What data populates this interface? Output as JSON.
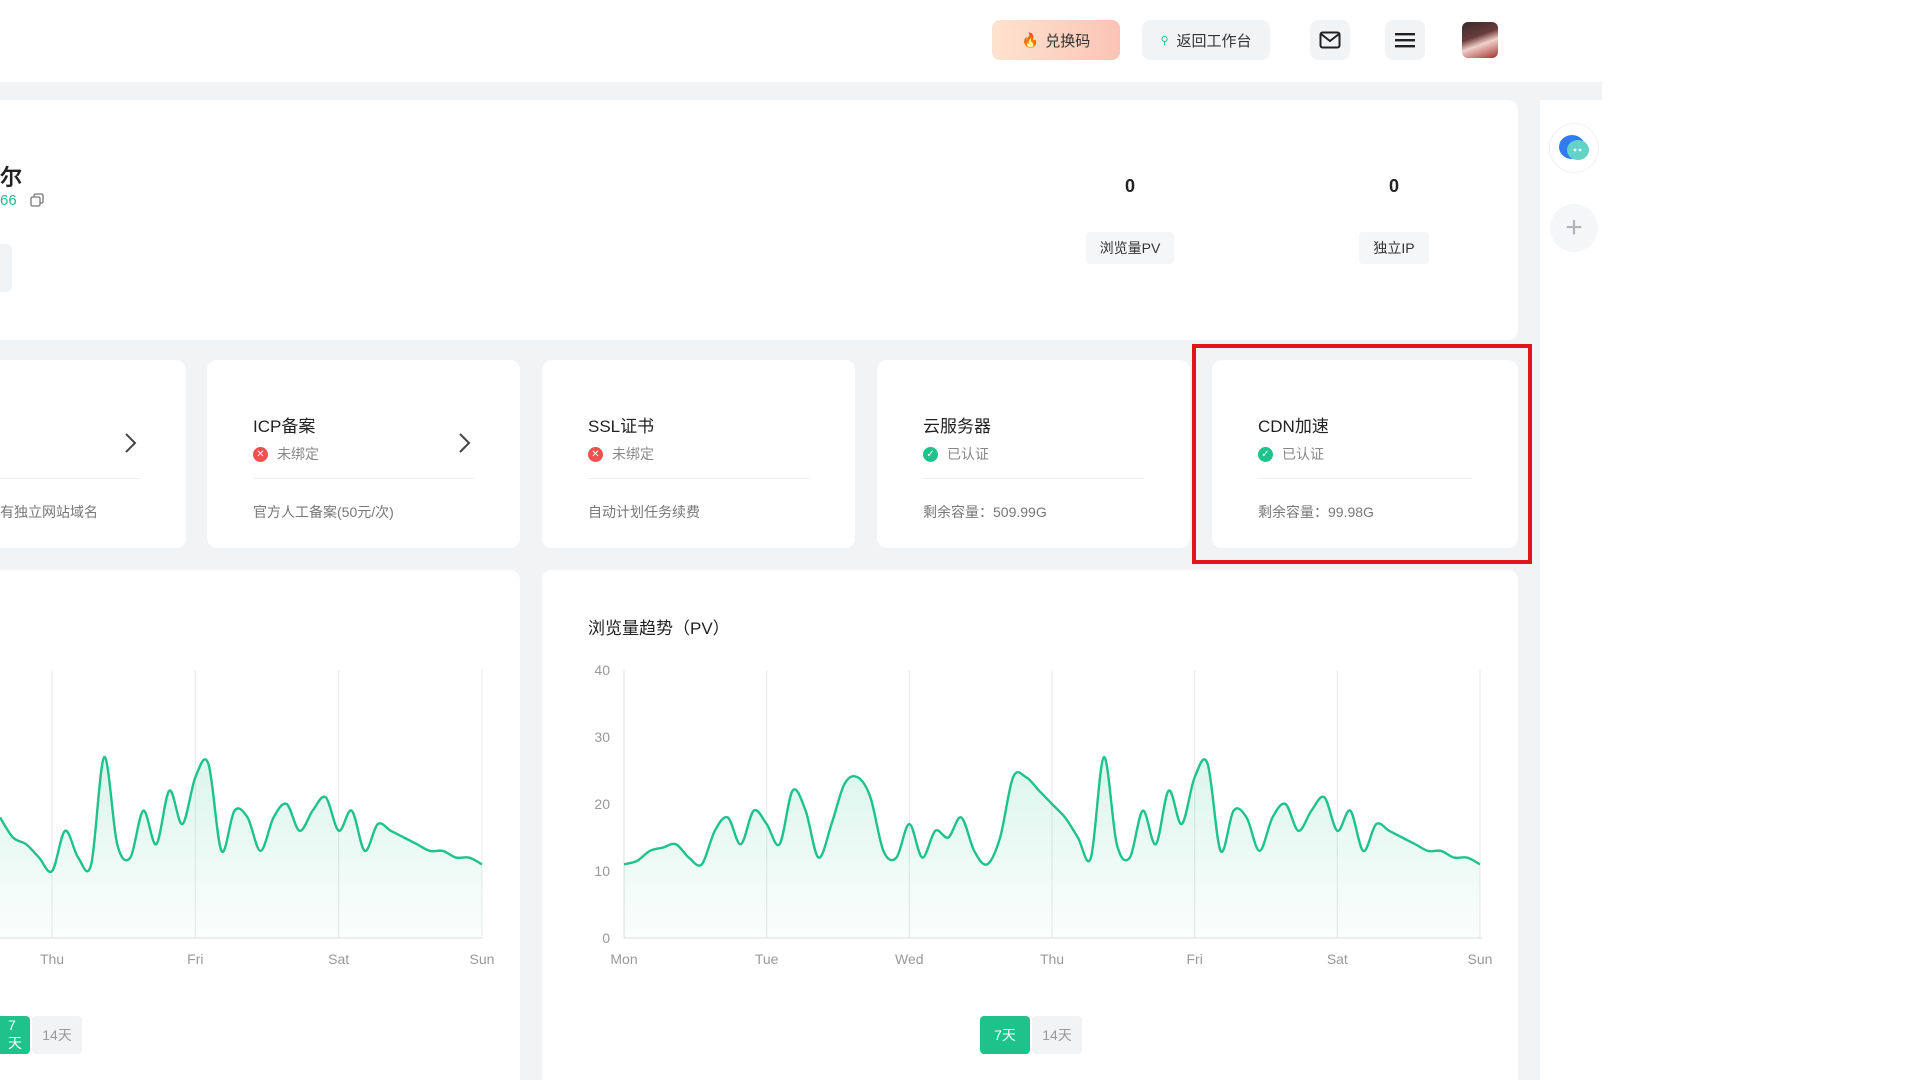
{
  "header": {
    "redeem_label": "兑换码",
    "back_label": "返回工作台"
  },
  "profile": {
    "name_fragment": "尔",
    "id_fragment": "66",
    "stats": [
      {
        "value": "0",
        "label": "浏览量PV"
      },
      {
        "value": "0",
        "label": "独立IP"
      }
    ]
  },
  "services": [
    {
      "title": "",
      "status": "",
      "note": "有独立网站域名",
      "ok": null
    },
    {
      "title": "ICP备案",
      "status": "未绑定",
      "note": "官方人工备案(50元/次)",
      "ok": false
    },
    {
      "title": "SSL证书",
      "status": "未绑定",
      "note": "自动计划任务续费",
      "ok": false
    },
    {
      "title": "云服务器",
      "status": "已认证",
      "note": "剩余容量：509.99G",
      "ok": true
    },
    {
      "title": "CDN加速",
      "status": "已认证",
      "note": "剩余容量：99.98G",
      "ok": true
    }
  ],
  "range_options": {
    "active": "7天",
    "inactive": "14天"
  },
  "colors": {
    "accent": "#1ec28b",
    "error": "#f0514f",
    "highlight": "#e01515"
  },
  "chart_data": [
    {
      "type": "area",
      "title": "",
      "x": [
        "Thu",
        "Fri",
        "Sat",
        "Sun"
      ],
      "ylim": [
        0,
        40
      ],
      "series": [
        {
          "values": [
            18,
            15,
            14,
            12,
            10,
            16,
            12,
            11,
            27,
            14,
            12,
            19,
            14,
            22,
            17,
            24,
            26,
            13,
            19,
            18,
            13,
            18,
            20,
            16,
            19,
            21,
            16,
            19,
            13,
            17,
            16,
            15,
            14,
            13,
            13,
            12,
            12,
            11
          ]
        }
      ]
    },
    {
      "type": "area",
      "title": "浏览量趋势（PV）",
      "x": [
        "Mon",
        "Tue",
        "Wed",
        "Thu",
        "Fri",
        "Sat",
        "Sun"
      ],
      "yticks": [
        0,
        10,
        20,
        30,
        40
      ],
      "ylim": [
        0,
        40
      ],
      "series": [
        {
          "values": [
            11,
            11.5,
            13,
            13.5,
            14,
            12,
            11,
            16,
            18,
            14,
            19,
            17,
            14,
            22,
            19,
            12,
            17,
            23,
            24,
            21,
            13,
            12,
            17,
            12,
            16,
            15,
            18,
            13,
            11,
            15,
            24,
            24,
            22,
            20,
            18,
            15,
            12,
            27,
            14,
            12,
            19,
            14,
            22,
            17,
            24,
            26,
            13,
            19,
            18,
            13,
            18,
            20,
            16,
            19,
            21,
            16,
            19,
            13,
            17,
            16,
            15,
            14,
            13,
            13,
            12,
            12,
            11
          ]
        }
      ]
    }
  ]
}
